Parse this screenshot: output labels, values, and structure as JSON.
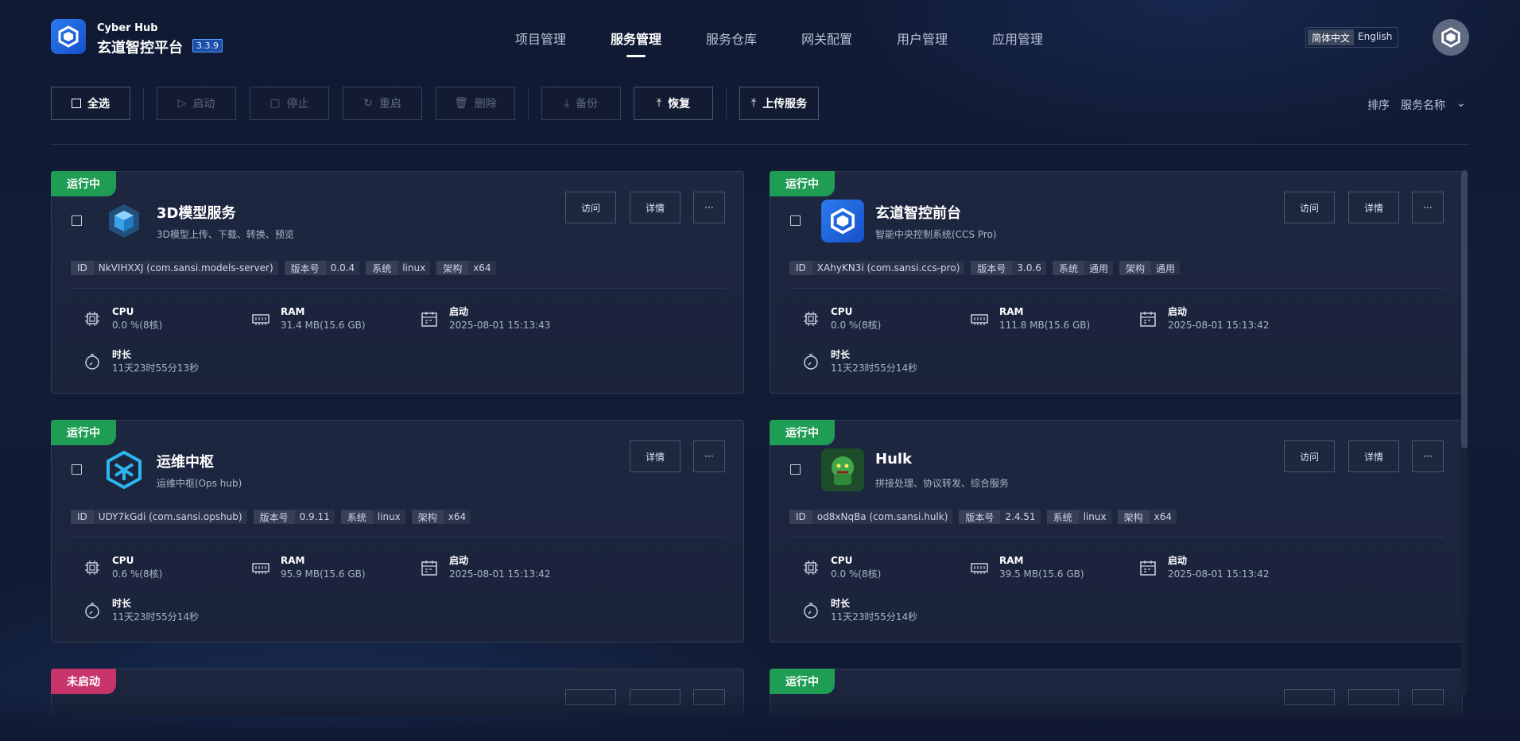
{
  "brand": {
    "sub": "Cyber Hub",
    "title": "玄道智控平台",
    "version": "3.3.9"
  },
  "nav": [
    "项目管理",
    "服务管理",
    "服务仓库",
    "网关配置",
    "用户管理",
    "应用管理"
  ],
  "lang": {
    "zh": "简体中文",
    "en": "English"
  },
  "toolbar": {
    "select_all": "全选",
    "start": "启动",
    "stop": "停止",
    "restart": "重启",
    "delete": "删除",
    "backup": "备份",
    "restore": "恢复",
    "upload": "上传服务"
  },
  "sort": {
    "label": "排序",
    "value": "服务名称"
  },
  "labels": {
    "cpu": "CPU",
    "ram": "RAM",
    "start": "启动",
    "duration": "时长",
    "visit": "访问",
    "detail": "详情",
    "more": "···",
    "id": "ID",
    "ver": "版本号",
    "os": "系统",
    "arch": "架构"
  },
  "cards": [
    {
      "status": "运行中",
      "name": "3D模型服务",
      "desc": "3D模型上传、下载、转换、预览",
      "id": "NkVIHXXJ (com.sansi.models-server)",
      "ver": "0.0.4",
      "os": "linux",
      "arch": "x64",
      "cpu": "0.0 %(8核)",
      "ram": "31.4 MB(15.6 GB)",
      "start": "2025-08-01 15:13:43",
      "duration": "11天23时55分13秒"
    },
    {
      "status": "运行中",
      "name": "玄道智控前台",
      "desc": "智能中央控制系统(CCS Pro)",
      "id": "XAhyKN3i (com.sansi.ccs-pro)",
      "ver": "3.0.6",
      "os": "通用",
      "arch": "通用",
      "cpu": "0.0 %(8核)",
      "ram": "111.8 MB(15.6 GB)",
      "start": "2025-08-01 15:13:42",
      "duration": "11天23时55分14秒"
    },
    {
      "status": "运行中",
      "name": "运维中枢",
      "desc": "运维中枢(Ops hub)",
      "id": "UDY7kGdi (com.sansi.opshub)",
      "ver": "0.9.11",
      "os": "linux",
      "arch": "x64",
      "cpu": "0.6 %(8核)",
      "ram": "95.9 MB(15.6 GB)",
      "start": "2025-08-01 15:13:42",
      "duration": "11天23时55分14秒"
    },
    {
      "status": "运行中",
      "name": "Hulk",
      "desc": "拼接处理、协议转发、综合服务",
      "id": "od8xNqBa (com.sansi.hulk)",
      "ver": "2.4.51",
      "os": "linux",
      "arch": "x64",
      "cpu": "0.0 %(8核)",
      "ram": "39.5 MB(15.6 GB)",
      "start": "2025-08-01 15:13:42",
      "duration": "11天23时55分14秒"
    },
    {
      "status": "未启动"
    },
    {
      "status": "运行中"
    }
  ],
  "colors": {
    "running": "#1f9d55",
    "stopped": "#c8356a",
    "accent": "#2c7cf0"
  }
}
